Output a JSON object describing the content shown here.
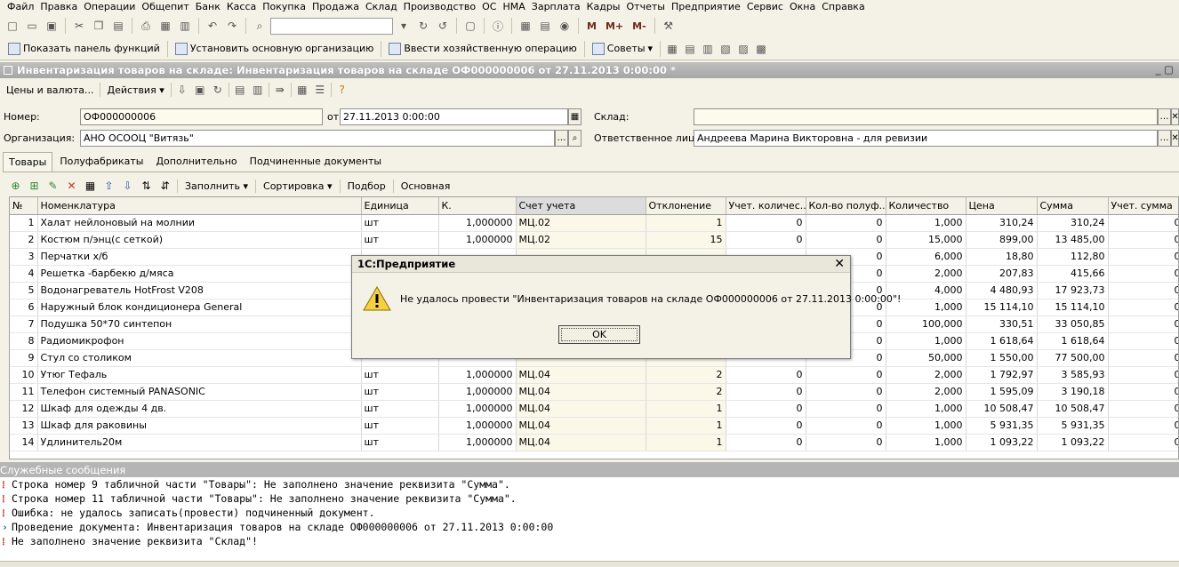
{
  "menu": [
    "Файл",
    "Правка",
    "Операции",
    "Общепит",
    "Банк",
    "Касса",
    "Покупка",
    "Продажа",
    "Склад",
    "Производство",
    "ОС",
    "НМА",
    "Зарплата",
    "Кадры",
    "Отчеты",
    "Предприятие",
    "Сервис",
    "Окна",
    "Справка"
  ],
  "toolbar1": {
    "m_labels": [
      "M",
      "M+",
      "M-"
    ]
  },
  "toolbar2": {
    "show_panel": "Показать панель функций",
    "set_org": "Установить основную организацию",
    "enter_op": "Ввести хозяйственную операцию",
    "tips": "Советы"
  },
  "document": {
    "title": "Инвентаризация товаров на складе: Инвентаризация товаров на складе ОФ000000006 от 27.11.2013 0:00:00 *",
    "toolbar": {
      "prices": "Цены и валюта...",
      "actions": "Действия"
    },
    "number_label": "Номер:",
    "number_value": "ОФ000000006",
    "date_label": "от:",
    "date_value": "27.11.2013  0:00:00",
    "warehouse_label": "Склад:",
    "warehouse_value": "",
    "org_label": "Организация:",
    "org_value": "АНО ОСООЦ \"Витязь\"",
    "resp_label": "Ответственное лицо:",
    "resp_value": "Андреева Марина Викторовна - для ревизии"
  },
  "tabs": [
    "Товары",
    "Полуфабрикаты",
    "Дополнительно",
    "Подчиненные документы"
  ],
  "grid_toolbar": {
    "fill": "Заполнить",
    "sort": "Сортировка",
    "select": "Подбор",
    "main": "Основная"
  },
  "table": {
    "headers": [
      "№",
      "Номенклатура",
      "Единица",
      "К.",
      "Счет учета",
      "Отклонение",
      "Учет. количес...",
      "Кол-во полуф...",
      "Количество",
      "Цена",
      "Сумма",
      "Учет. сумма"
    ],
    "rows": [
      [
        "1",
        "Халат нейлоновый на молнии",
        "шт",
        "1,000000",
        "МЦ.02",
        "1",
        "0",
        "0",
        "1,000",
        "310,24",
        "310,24",
        "0"
      ],
      [
        "2",
        "Костюм п/энц(с сеткой)",
        "шт",
        "1,000000",
        "МЦ.02",
        "15",
        "0",
        "0",
        "15,000",
        "899,00",
        "13 485,00",
        "0"
      ],
      [
        "3",
        "Перчатки х/б",
        "",
        "",
        "",
        "",
        "",
        "0",
        "6,000",
        "18,80",
        "112,80",
        "0"
      ],
      [
        "4",
        "Решетка -барбекю д/мяса",
        "",
        "",
        "",
        "",
        "",
        "0",
        "2,000",
        "207,83",
        "415,66",
        "0"
      ],
      [
        "5",
        "Водонагреватель HotFrost V208",
        "",
        "",
        "",
        "",
        "",
        "0",
        "4,000",
        "4 480,93",
        "17 923,73",
        "0"
      ],
      [
        "6",
        "Наружный блок кондиционера General",
        "",
        "",
        "",
        "",
        "",
        "0",
        "1,000",
        "15 114,10",
        "15 114,10",
        "0"
      ],
      [
        "7",
        "Подушка 50*70 синтепон",
        "",
        "",
        "",
        "",
        "",
        "0",
        "100,000",
        "330,51",
        "33 050,85",
        "0"
      ],
      [
        "8",
        "Радиомикрофон",
        "",
        "",
        "",
        "",
        "",
        "0",
        "1,000",
        "1 618,64",
        "1 618,64",
        "0"
      ],
      [
        "9",
        "Стул  со столиком",
        "",
        "",
        "",
        "",
        "",
        "0",
        "50,000",
        "1 550,00",
        "77 500,00",
        "0"
      ],
      [
        "10",
        "Утюг Тефаль",
        "шт",
        "1,000000",
        "МЦ.04",
        "2",
        "0",
        "0",
        "2,000",
        "1 792,97",
        "3 585,93",
        "0"
      ],
      [
        "11",
        "Телефон системный PANASONIC",
        "шт",
        "1,000000",
        "МЦ.04",
        "2",
        "0",
        "0",
        "2,000",
        "1 595,09",
        "3 190,18",
        "0"
      ],
      [
        "12",
        "Шкаф для одежды 4 дв.",
        "шт",
        "1,000000",
        "МЦ.04",
        "1",
        "0",
        "0",
        "1,000",
        "10 508,47",
        "10 508,47",
        "0"
      ],
      [
        "13",
        "Шкаф для раковины",
        "шт",
        "1,000000",
        "МЦ.04",
        "1",
        "0",
        "0",
        "1,000",
        "5 931,35",
        "5 931,35",
        "0"
      ],
      [
        "14",
        "Удлинитель20м",
        "шт",
        "1,000000",
        "МЦ.04",
        "1",
        "0",
        "0",
        "1,000",
        "1 093,22",
        "1 093,22",
        "0"
      ]
    ]
  },
  "messages": {
    "title": "Служебные сообщения",
    "lines": [
      "Строка номер 9 табличной части \"Товары\": Не заполнено значение реквизита \"Сумма\".",
      "Строка номер 11 табличной части \"Товары\": Не заполнено значение реквизита \"Сумма\".",
      "Ошибка: не удалось записать(провести) подчиненный документ.",
      "Проведение документа: Инвентаризация товаров на складе ОФ000000006 от 27.11.2013 0:00:00",
      "Не заполнено значение реквизита \"Склад\"!"
    ]
  },
  "dialog": {
    "title": "1С:Предприятие",
    "message": "Не удалось провести \"Инвентаризация товаров на складе ОФ000000006 от 27.11.2013 0:00:00\"!",
    "ok": "OK"
  }
}
